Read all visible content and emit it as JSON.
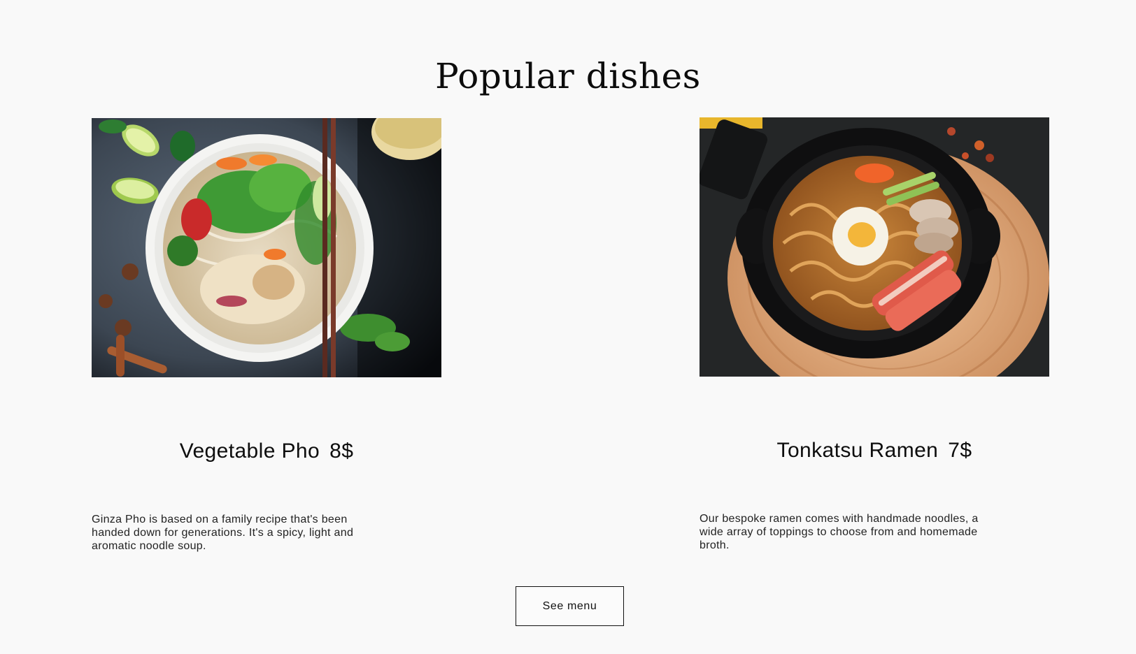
{
  "section": {
    "title": "Popular dishes"
  },
  "dishes": [
    {
      "name": "Vegetable Pho",
      "price": "8$",
      "description": "Ginza Pho is based on a family recipe that's been handed down for generations. It's a spicy, light and aromatic noodle soup.",
      "image": "pho-bowl-photo"
    },
    {
      "name": "Tonkatsu Ramen",
      "price": "7$",
      "description": "Our bespoke ramen comes with handmade noodles, a wide array of toppings to choose from and homemade broth.",
      "image": "ramen-bowl-photo"
    }
  ],
  "cta": {
    "label": "See menu"
  },
  "colors": {
    "background": "#f9f9f9",
    "text": "#111111",
    "button_border": "#111111"
  }
}
